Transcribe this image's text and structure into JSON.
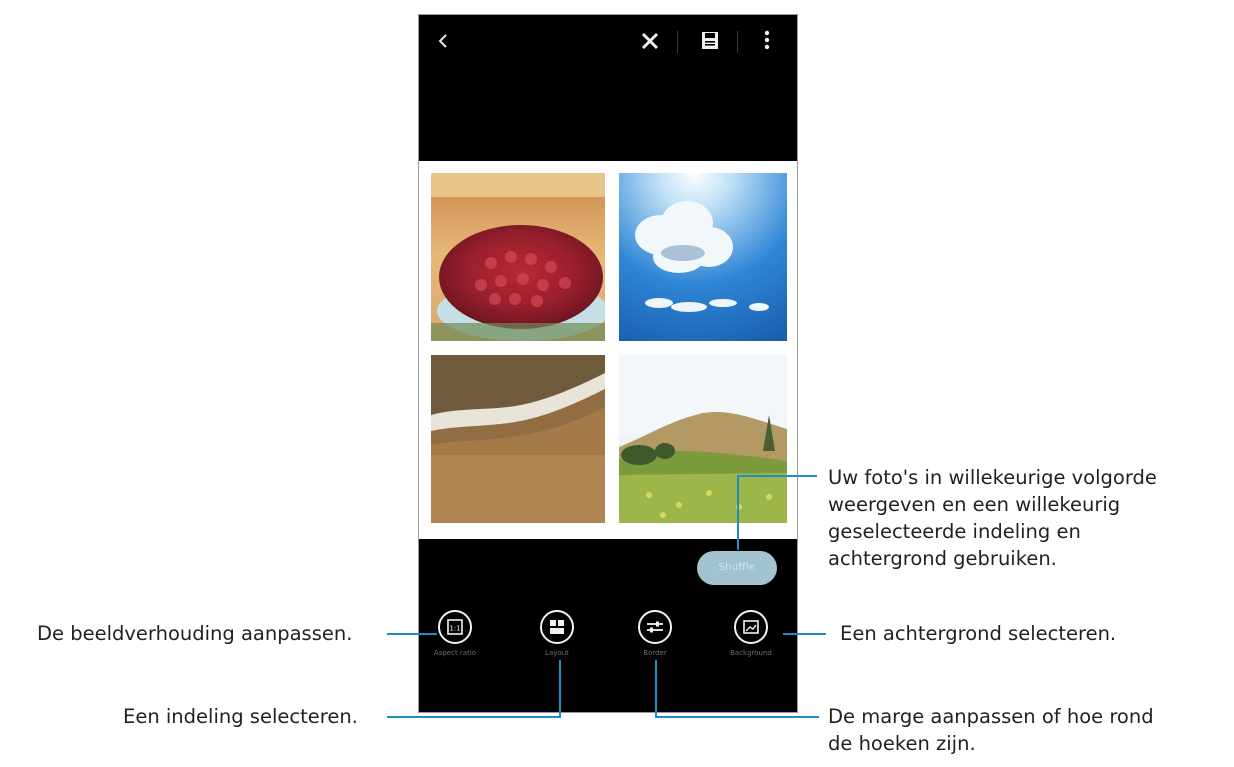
{
  "toolbar": {
    "back_icon": "chevron-left-icon",
    "close_icon": "close-icon",
    "save_icon": "save-icon",
    "more_icon": "more-vertical-icon"
  },
  "collage": {
    "photos": [
      "cake-photo",
      "sky-cloud-photo",
      "beach-sand-photo",
      "hill-landscape-photo"
    ]
  },
  "shuffle_button": {
    "label": "Shuffle"
  },
  "bottom_tools": [
    {
      "label": "Aspect ratio",
      "icon": "aspect-ratio-icon"
    },
    {
      "label": "Layout",
      "icon": "layout-icon"
    },
    {
      "label": "Border",
      "icon": "border-icon"
    },
    {
      "label": "Background",
      "icon": "background-icon"
    }
  ],
  "annotations": {
    "shuffle_line1": "Uw foto's in willekeurige volgorde",
    "shuffle_line2": "weergeven en een willekeurig",
    "shuffle_line3": "geselecteerde indeling en",
    "shuffle_line4": "achtergrond gebruiken.",
    "aspect_ratio": "De beeldverhouding aanpassen.",
    "background": "Een achtergrond selecteren.",
    "layout": "Een indeling selecteren.",
    "border_line1": "De marge aanpassen of hoe rond",
    "border_line2": "de hoeken zijn."
  },
  "colors": {
    "accent_line": "#1e8fc6",
    "shuffle_button": "#a3c2d1",
    "screen_bg": "#000000"
  }
}
